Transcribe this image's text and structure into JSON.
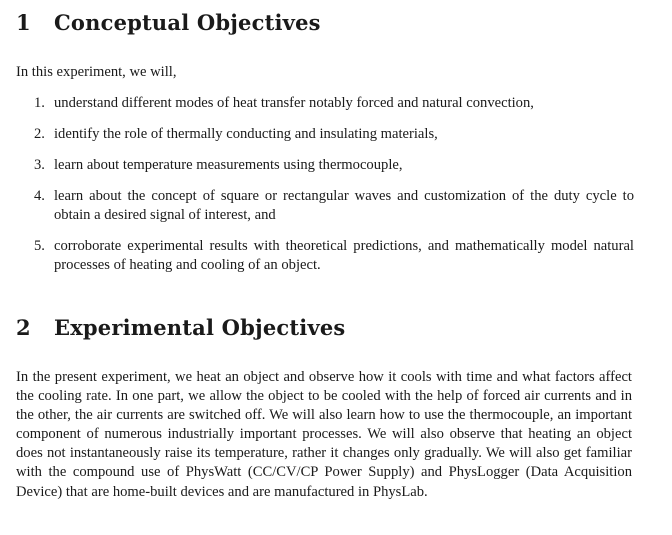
{
  "section1": {
    "number": "1",
    "title": "Conceptual Objectives",
    "intro": "In this experiment, we will,",
    "items": [
      {
        "marker": "1.",
        "text": "understand different modes of heat transfer notably forced and natural convection,"
      },
      {
        "marker": "2.",
        "text": "identify the role of thermally conducting and insulating materials,"
      },
      {
        "marker": "3.",
        "text": "learn about temperature measurements using thermocouple,"
      },
      {
        "marker": "4.",
        "text": "learn about the concept of square or rectangular waves and customization of the duty cycle to obtain a desired signal of interest, and"
      },
      {
        "marker": "5.",
        "text": "corroborate experimental results with theoretical predictions, and mathematically model natural processes of heating and cooling of an object."
      }
    ]
  },
  "section2": {
    "number": "2",
    "title": "Experimental Objectives",
    "paragraph": "In the present experiment, we heat an object and observe how it cools with time and what factors affect the cooling rate. In one part, we allow the object to be cooled with the help of forced air currents and in the other, the air currents are switched off. We will also learn how to use the thermocouple, an important component of numerous industrially important processes. We will also observe that heating an object does not instantaneously raise its temperature, rather it changes only gradually. We will also get familiar with the compound use of PhysWatt (CC/CV/CP Power Supply) and PhysLogger (Data Acquisition Device) that are home-built devices and are manufactured in PhysLab."
  }
}
